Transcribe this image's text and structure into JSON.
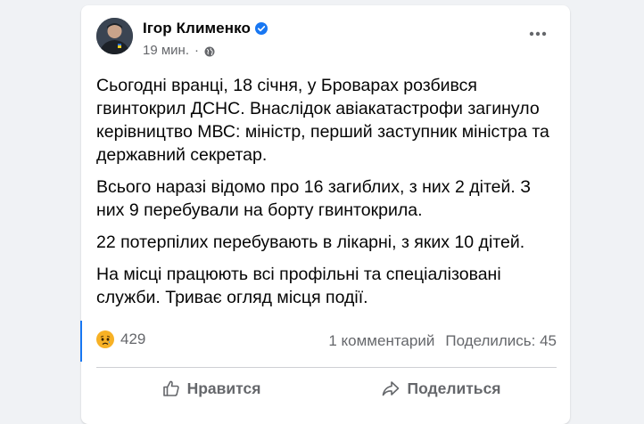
{
  "post": {
    "author": "Ігор Клименко",
    "time": "19 мин.",
    "dot": "·",
    "paragraphs": [
      "Сьогодні вранці, 18 січня, у Броварах розбився гвинтокрил ДСНС. Внаслідок авіакатастрофи загинуло керівництво МВС: міністр, перший заступник міністра та державний секретар.",
      "Всього наразі відомо про 16 загиблих, з них 2 дітей. З них 9 перебували на борту гвинтокрила.",
      "22 потерпілих перебувають в лікарні, з яких 10 дітей.",
      "На місці працюють всі профільні та спеціалізовані служби. Триває огляд місця події."
    ]
  },
  "stats": {
    "reaction_icon": "sad-face-icon",
    "reactions": "429",
    "comments": "1 комментарий",
    "shares": "Поделились: 45"
  },
  "actions": {
    "like_label": "Нравится",
    "share_label": "Поделиться"
  },
  "colors": {
    "accent": "#1877f2",
    "text": "#050505",
    "secondary": "#65676b",
    "card": "#ffffff",
    "background": "#f0f2f5",
    "reaction": "#f7b125"
  }
}
